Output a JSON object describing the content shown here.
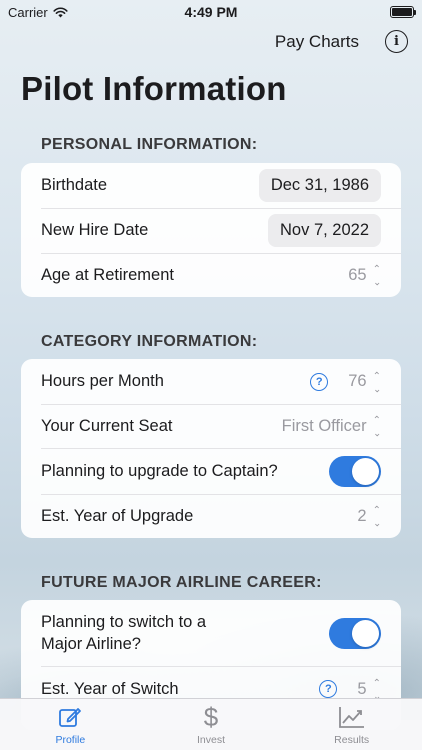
{
  "status": {
    "carrier": "Carrier",
    "time": "4:49 PM"
  },
  "nav": {
    "pay_charts": "Pay Charts",
    "info_glyph": "i"
  },
  "page": {
    "title": "Pilot Information"
  },
  "personal": {
    "header": "PERSONAL INFORMATION:",
    "birthdate_label": "Birthdate",
    "birthdate_value": "Dec 31, 1986",
    "hire_label": "New Hire Date",
    "hire_value": "Nov 7, 2022",
    "retirement_label": "Age at Retirement",
    "retirement_value": "65"
  },
  "category": {
    "header": "CATEGORY INFORMATION:",
    "hours_label": "Hours per Month",
    "hours_value": "76",
    "seat_label": "Your Current Seat",
    "seat_value": "First Officer",
    "upgrade_label": "Planning to upgrade to Captain?",
    "upgrade_on": true,
    "upgrade_year_label": "Est. Year of Upgrade",
    "upgrade_year_value": "2"
  },
  "future": {
    "header": "FUTURE MAJOR AIRLINE CAREER:",
    "switch_label_1": "Planning to switch to a",
    "switch_label_2": "Major Airline?",
    "switch_on": true,
    "switch_year_label": "Est. Year of Switch",
    "switch_year_value": "5"
  },
  "tabs": [
    {
      "label": "Profile",
      "icon": "edit-icon",
      "active": true
    },
    {
      "label": "Invest",
      "icon": "dollar-icon",
      "active": false
    },
    {
      "label": "Results",
      "icon": "chart-icon",
      "active": false
    }
  ],
  "colors": {
    "accent": "#2f7bdf"
  }
}
